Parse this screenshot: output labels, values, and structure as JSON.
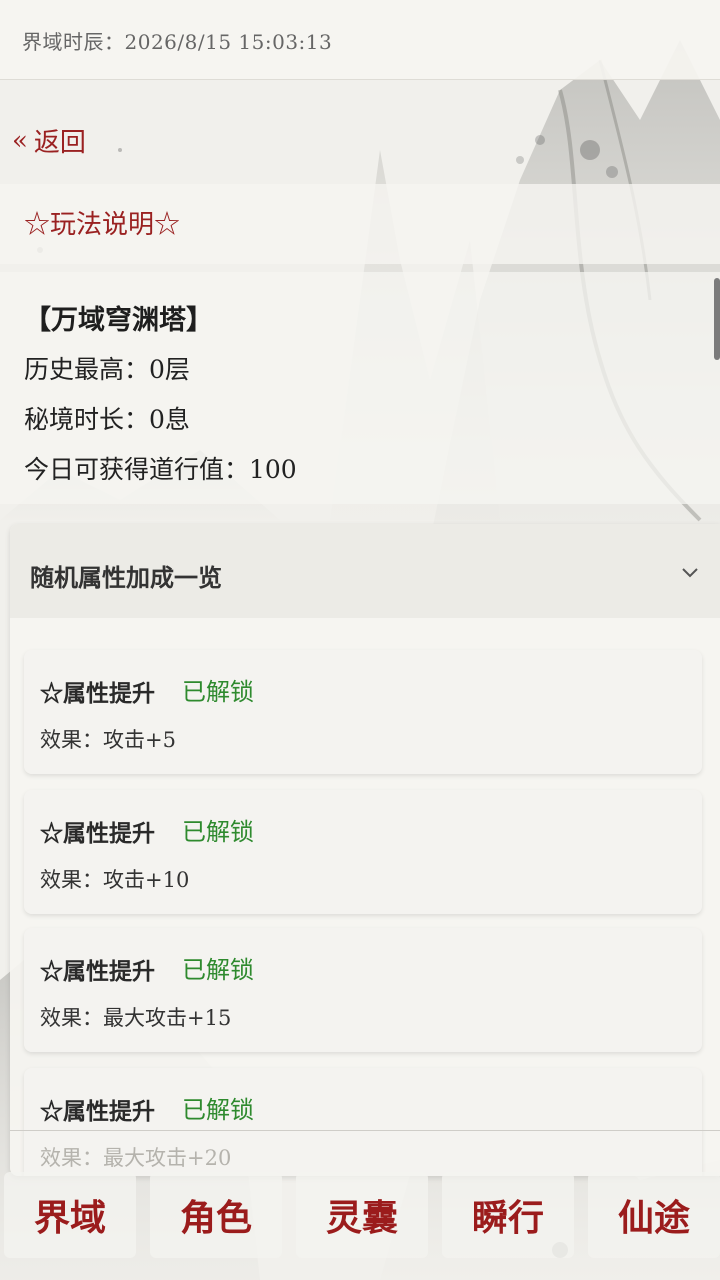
{
  "status_bar": {
    "clock": "界域时辰：2026/8/15  15:03:13"
  },
  "back": {
    "icon": "double-chevron-left-icon",
    "label": "返回"
  },
  "rules": {
    "label": "☆玩法说明☆"
  },
  "stats": {
    "tower_name": "【万域穹渊塔】",
    "history_best": "历史最高：0层",
    "realm_time": "秘境时长：0息",
    "daily_dao": "今日可获得道行值：100"
  },
  "bonus_panel": {
    "title": "随机属性加成一览",
    "expand_icon": "chevron-down-icon",
    "items": [
      {
        "title": "☆属性提升",
        "status": "已解锁",
        "effect": "效果：攻击+5"
      },
      {
        "title": "☆属性提升",
        "status": "已解锁",
        "effect": "效果：攻击+10"
      },
      {
        "title": "☆属性提升",
        "status": "已解锁",
        "effect": "效果：最大攻击+15"
      },
      {
        "title": "☆属性提升",
        "status": "已解锁",
        "effect": "效果：最大攻击+20"
      }
    ]
  },
  "bottom_nav": [
    "界域",
    "角色",
    "灵囊",
    "瞬行",
    "仙途"
  ],
  "colors": {
    "accent": "#9a2121",
    "unlocked": "#2e8a2e",
    "background": "#f1f0ec"
  }
}
